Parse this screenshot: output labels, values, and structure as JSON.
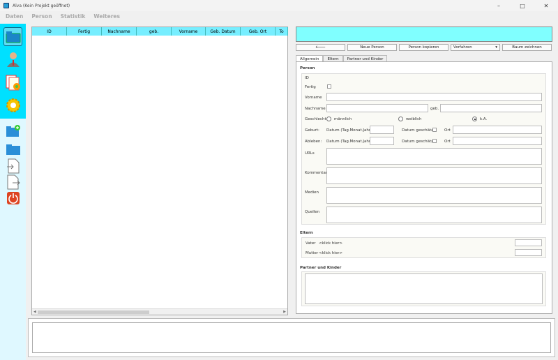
{
  "window": {
    "title": "Alva (Kein Projekt geöffnet)",
    "minimize": "–",
    "maximize": "□",
    "close": "✕"
  },
  "menu": [
    "Daten",
    "Person",
    "Statistik",
    "Weiteres"
  ],
  "toolbar_icons": [
    "folder-tab-icon",
    "person-icon",
    "documents-icon",
    "gear-icon",
    "new-folder-icon",
    "folder-icon",
    "import-icon",
    "export-icon",
    "power-icon"
  ],
  "table": {
    "columns": [
      "ID",
      "Fertig",
      "Nachname",
      "geb.",
      "Vorname",
      "Geb. Datum",
      "Geb. Ort",
      "To"
    ]
  },
  "buttons": {
    "back": "🡐",
    "new_person": "Neue Person",
    "copy_person": "Person kopieren",
    "ancestors": "Vorfahren",
    "draw_tree": "Baum zeichnen"
  },
  "tabs": [
    "Allgemein",
    "Eltern",
    "Partner und Kinder"
  ],
  "person": {
    "section": "Person",
    "id_label": "ID",
    "fertig_label": "Fertig",
    "vorname_label": "Vorname",
    "nachname_label": "Nachname",
    "geb_label": "geb.",
    "geschlecht_label": "Geschlecht",
    "male": "männlich",
    "female": "weiblich",
    "na": "k.A.",
    "geburt_label": "Geburt:",
    "ableben_label": "Ableben:",
    "date_hint": "Datum (Tag.Monat.Jahr)",
    "estimated": "Datum geschätzt",
    "ort": "Ort",
    "urls": "URLs",
    "kommentar": "Kommentar",
    "medien": "Medien",
    "quellen": "Quellen"
  },
  "eltern": {
    "section": "Eltern",
    "vater_label": "Vater",
    "vater_value": "<klick hier>",
    "mutter_label": "Mutter",
    "mutter_value": "<klick hier>"
  },
  "partner": {
    "section": "Partner und Kinder"
  },
  "colors": {
    "accent": "#00e0ff",
    "header": "#77eeff",
    "banner": "#80ffff"
  }
}
